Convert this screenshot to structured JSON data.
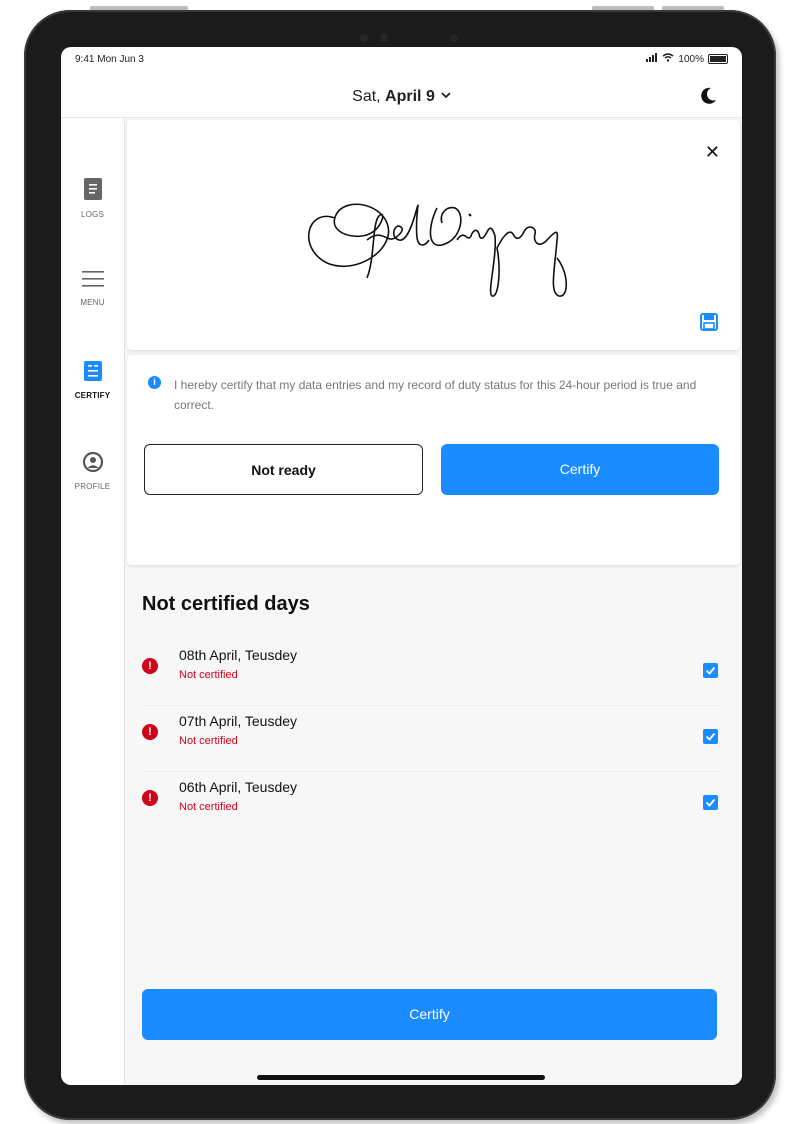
{
  "status_bar": {
    "time": "9:41 Mon Jun 3",
    "battery": "100%"
  },
  "header": {
    "date_prefix": "Sat, ",
    "date_main": "April 9",
    "chevron": "⌄"
  },
  "sidebar": {
    "items": [
      {
        "label": "LOGS",
        "icon": "logs-icon",
        "active": false
      },
      {
        "label": "MENU",
        "icon": "menu-icon",
        "active": false
      },
      {
        "label": "CERTIFY",
        "icon": "certify-icon",
        "active": true
      },
      {
        "label": "PROFILE",
        "icon": "profile-icon",
        "active": false
      }
    ]
  },
  "signature_card": {
    "close": "✕"
  },
  "certify_card": {
    "statement": "I hereby certify that my data entries and my record of duty status for this 24-hour period is true and correct.",
    "not_ready_label": "Not ready",
    "certify_label": "Certify"
  },
  "not_certified": {
    "title": "Not certified days",
    "days": [
      {
        "date": "08th April, Teusdey",
        "status": "Not certified",
        "checked": true
      },
      {
        "date": "07th April, Teusdey",
        "status": "Not certified",
        "checked": true
      },
      {
        "date": "06th April, Teusdey",
        "status": "Not certified",
        "checked": true
      }
    ]
  },
  "bottom_button": {
    "label": "Certify"
  },
  "colors": {
    "accent": "#1a8cff",
    "error": "#d0021b"
  }
}
